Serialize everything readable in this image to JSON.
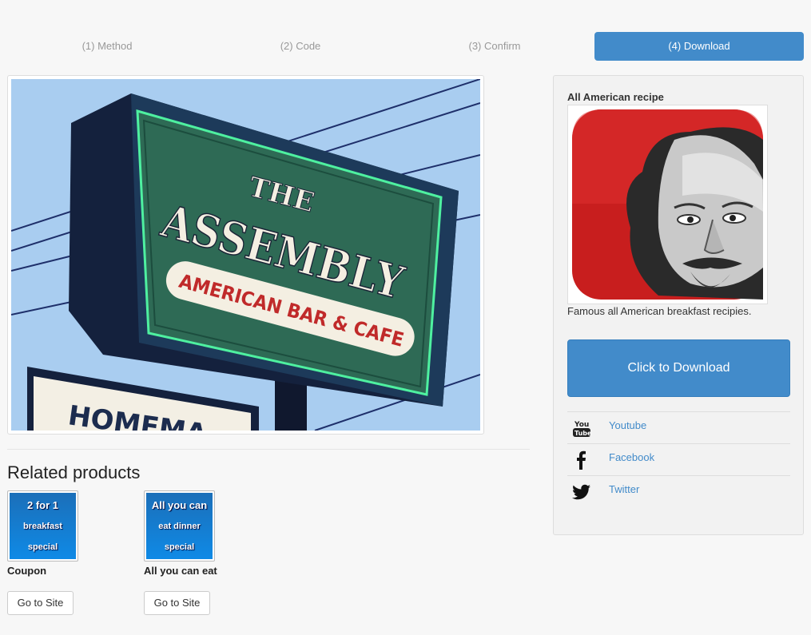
{
  "steps": [
    {
      "label": "(1) Method"
    },
    {
      "label": "(2) Code"
    },
    {
      "label": "(3) Confirm"
    },
    {
      "label": "(4) Download",
      "active": true
    }
  ],
  "main_image": {
    "sign": {
      "line1": "THE",
      "line2": "ASSEMBLY",
      "line3": "AMERICAN BAR & CAFE",
      "lower": "HOMEMA"
    }
  },
  "related": {
    "title": "Related products",
    "products": [
      {
        "thumb_lines": [
          "2 for 1",
          "breakfast",
          "special"
        ],
        "name": "Coupon",
        "button": "Go to Site"
      },
      {
        "thumb_lines": [
          "All you can",
          "eat dinner",
          "special"
        ],
        "name": "All you can eat",
        "button": "Go to Site"
      }
    ]
  },
  "sidebar": {
    "recipe_title": "All American recipe",
    "recipe_desc": "Famous all American breakfast recipies.",
    "download_label": "Click to Download",
    "social": [
      {
        "label": "Youtube",
        "icon": "youtube-icon"
      },
      {
        "label": "Facebook",
        "icon": "facebook-icon"
      },
      {
        "label": "Twitter",
        "icon": "twitter-icon"
      }
    ]
  },
  "colors": {
    "accent": "#428bca",
    "page_bg": "#f7f7f7",
    "sidebar_bg": "#f2f2f2"
  }
}
